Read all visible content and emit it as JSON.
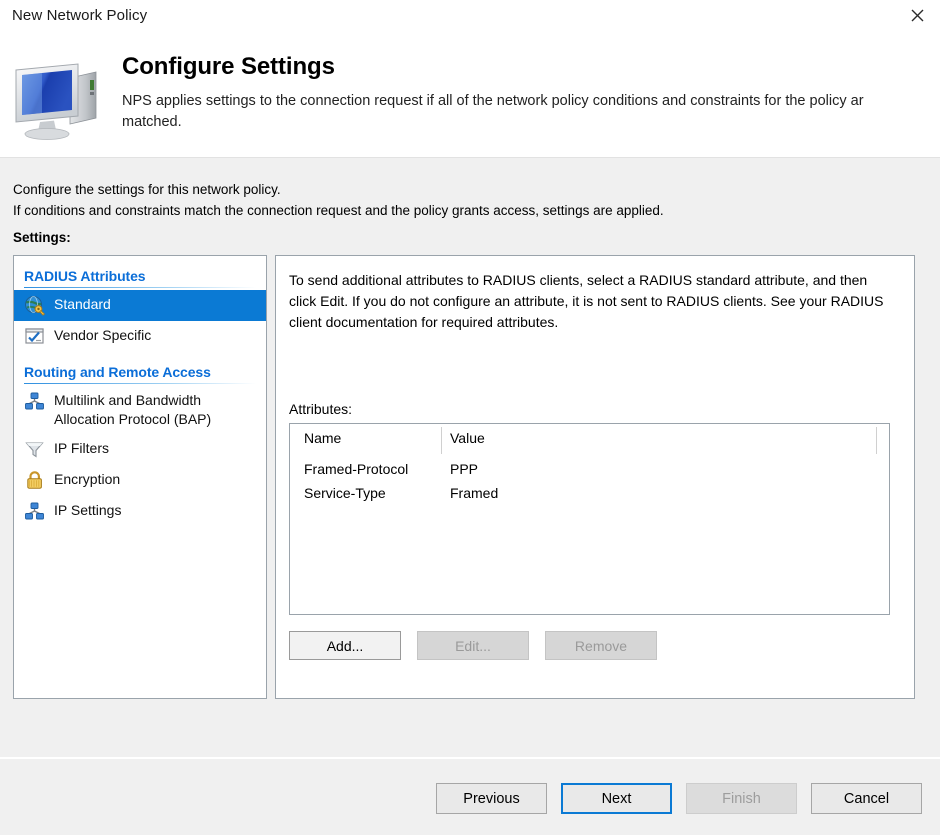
{
  "window": {
    "title": "New Network Policy",
    "close_icon": "close-icon"
  },
  "banner": {
    "icon": "computer-monitor-icon",
    "title": "Configure Settings",
    "description": "NPS applies settings to the connection request if all of the network policy conditions and constraints for the policy ar\nmatched."
  },
  "intro": {
    "line1": "Configure the settings for this network policy.",
    "line2": "If conditions and constraints match the connection request and the policy grants access, settings are applied.",
    "settings_label": "Settings:"
  },
  "tree": {
    "groups": [
      {
        "heading": "RADIUS Attributes",
        "items": [
          {
            "label": "Standard",
            "icon": "globe-key-icon",
            "selected": true
          },
          {
            "label": "Vendor Specific",
            "icon": "window-check-icon",
            "selected": false
          }
        ]
      },
      {
        "heading": "Routing and Remote Access",
        "items": [
          {
            "label": "Multilink and Bandwidth Allocation Protocol (BAP)",
            "icon": "network-nodes-icon",
            "selected": false
          },
          {
            "label": "IP Filters",
            "icon": "funnel-icon",
            "selected": false
          },
          {
            "label": "Encryption",
            "icon": "padlock-icon",
            "selected": false
          },
          {
            "label": "IP Settings",
            "icon": "network-nodes-icon",
            "selected": false
          }
        ]
      }
    ]
  },
  "content": {
    "description": "To send additional attributes to RADIUS clients, select a RADIUS standard attribute, and then click Edit. If you do not configure an attribute, it is not sent to RADIUS clients. See your RADIUS client documentation for required attributes.",
    "attributes_label": "Attributes:",
    "table": {
      "columns": [
        "Name",
        "Value"
      ],
      "rows": [
        {
          "name": "Framed-Protocol",
          "value": "PPP"
        },
        {
          "name": "Service-Type",
          "value": "Framed"
        }
      ]
    },
    "buttons": [
      {
        "label": "Add...",
        "enabled": true
      },
      {
        "label": "Edit...",
        "enabled": false
      },
      {
        "label": "Remove",
        "enabled": false
      }
    ]
  },
  "footer": {
    "buttons": [
      {
        "label": "Previous",
        "enabled": true,
        "default": false
      },
      {
        "label": "Next",
        "enabled": true,
        "default": true
      },
      {
        "label": "Finish",
        "enabled": false,
        "default": false
      },
      {
        "label": "Cancel",
        "enabled": true,
        "default": false
      }
    ]
  },
  "colors": {
    "accent": "#0b7ad4",
    "heading": "#0b6ed8",
    "body_bg": "#f0f0f0"
  }
}
